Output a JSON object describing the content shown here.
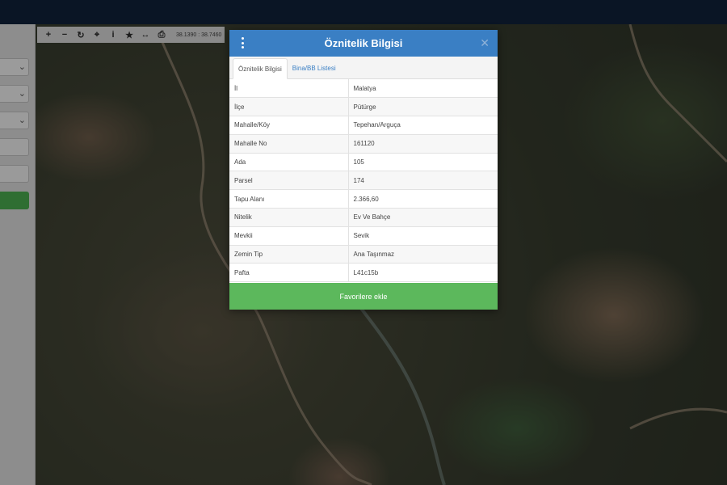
{
  "toolbar": {
    "icons": [
      "plus-icon",
      "minus-icon",
      "refresh-icon",
      "crosshair-icon",
      "info-icon",
      "star-icon",
      "measure-icon",
      "print-icon"
    ],
    "coordinates": "38.1390 : 38.7460"
  },
  "modal": {
    "title": "Öznitelik Bilgisi",
    "tabs": [
      {
        "label": "Öznitelik Bilgisi",
        "active": true
      },
      {
        "label": "Bina/BB Listesi",
        "active": false
      }
    ],
    "rows": [
      {
        "key": "İl",
        "value": "Malatya"
      },
      {
        "key": "İlçe",
        "value": "Pütürge"
      },
      {
        "key": "Mahalle/Köy",
        "value": "Tepehan/Arguça"
      },
      {
        "key": "Mahalle No",
        "value": "161120"
      },
      {
        "key": "Ada",
        "value": "105"
      },
      {
        "key": "Parsel",
        "value": "174"
      },
      {
        "key": "Tapu Alanı",
        "value": "2.366,60"
      },
      {
        "key": "Nitelik",
        "value": "Ev Ve Bahçe"
      },
      {
        "key": "Mevkii",
        "value": "Sevik"
      },
      {
        "key": "Zemin Tip",
        "value": "Ana Taşınmaz"
      },
      {
        "key": "Pafta",
        "value": "L41c15b"
      }
    ],
    "favorite_button": "Favorilere ekle"
  },
  "colors": {
    "header_blue": "#3a7fc4",
    "button_green": "#5cb85c",
    "topbar": "#0a1525"
  }
}
